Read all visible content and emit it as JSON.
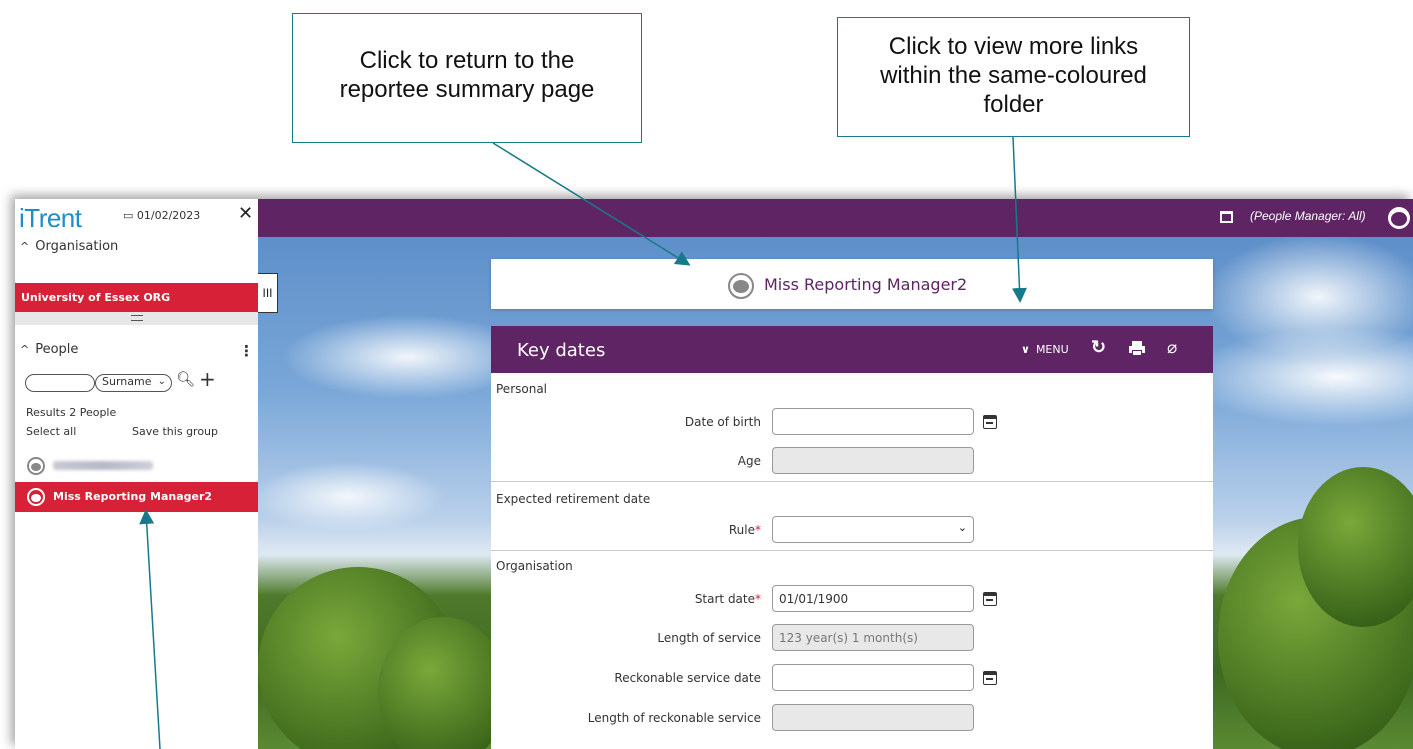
{
  "callouts": {
    "return_summary": "Click to return to the reportee summary page",
    "more_links": "Click to view more links within the same-coloured folder"
  },
  "colors": {
    "brand_purple": "#5e2464",
    "accent_red": "#d62136",
    "logo_blue": "#1e8fc6",
    "callout_border": "#167a8a"
  },
  "topbar": {
    "role": "(People Manager: All)",
    "window_icon": "window-icon",
    "user_icon": "user-avatar-icon"
  },
  "sidebar": {
    "logo": "iTrent",
    "date": "01/02/2023",
    "close_icon": "close-icon",
    "organisation_header": "Organisation",
    "organisation_item": "University of Essex ORG",
    "people_header": "People",
    "search_input_value": "",
    "search_select_value": "Surname",
    "results": "Results 2 People",
    "select_all": "Select all",
    "save_group": "Save this group",
    "people": [
      {
        "name": "",
        "selected": false
      },
      {
        "name": "Miss Reporting Manager2",
        "selected": true
      }
    ],
    "collapse_label": "III"
  },
  "person_card": {
    "name": "Miss Reporting Manager2"
  },
  "panel": {
    "title": "Key dates",
    "menu_label": "MENU",
    "sections": {
      "personal": "Personal",
      "expected_retirement": "Expected retirement date",
      "organisation": "Organisation"
    },
    "fields": {
      "date_of_birth": {
        "label": "Date of birth",
        "value": ""
      },
      "age": {
        "label": "Age",
        "value": ""
      },
      "rule": {
        "label": "Rule",
        "value": ""
      },
      "start_date": {
        "label": "Start date",
        "value": "01/01/1900"
      },
      "length_of_service": {
        "label": "Length of service",
        "value": "123 year(s) 1 month(s)"
      },
      "reckonable_service_date": {
        "label": "Reckonable service date",
        "value": ""
      },
      "length_of_reckonable_service": {
        "label": "Length of reckonable service",
        "value": ""
      }
    },
    "required_marker": "*"
  }
}
